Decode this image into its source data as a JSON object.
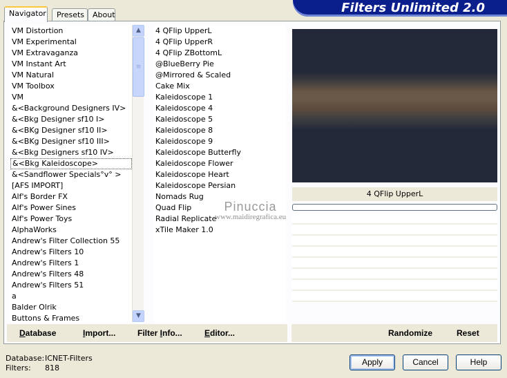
{
  "tabs": [
    {
      "label": "Navigator",
      "active": true
    },
    {
      "label": "Presets",
      "active": false
    },
    {
      "label": "About",
      "active": false
    }
  ],
  "banner": {
    "title": "Filters Unlimited 2.0"
  },
  "categories": [
    "VM Distortion",
    "VM Experimental",
    "VM Extravaganza",
    "VM Instant Art",
    "VM Natural",
    "VM Toolbox",
    "VM",
    "&<Background Designers IV>",
    "&<Bkg Designer sf10 I>",
    "&<BKg Designer sf10 II>",
    "&<BKg Designer sf10 III>",
    "&<Bkg Designers sf10 IV>",
    "&<Bkg Kaleidoscope>",
    "&<Sandflower Specials°v° >",
    "[AFS IMPORT]",
    "Alf's Border FX",
    "Alf's Power Sines",
    "Alf's Power Toys",
    "AlphaWorks",
    "Andrew's Filter Collection 55",
    "Andrew's Filters 10",
    "Andrew's Filters 1",
    "Andrew's Filters 48",
    "Andrew's Filters 51",
    "a",
    "Balder Olrik",
    "Buttons & Frames"
  ],
  "selected_category_index": 12,
  "filters": [
    "4 QFlip UpperL",
    "4 QFlip UpperR",
    "4 QFlip ZBottomL",
    "@BlueBerry Pie",
    "@Mirrored & Scaled",
    "Cake Mix",
    "Kaleidoscope 1",
    "Kaleidoscope 4",
    "Kaleidoscope 5",
    "Kaleidoscope 8",
    "Kaleidoscope 9",
    "Kaleidoscope Butterfly",
    "Kaleidoscope Flower",
    "Kaleidoscope Heart",
    "Kaleidoscope Persian",
    "Nomads Rug",
    "Quad Flip",
    "Radial Replicate",
    "xTile Maker 1.0"
  ],
  "selected_filter_index": 0,
  "preview": {
    "filter_name": "4 QFlip UpperL",
    "progress": 0
  },
  "watermark": {
    "line1": "Pinuccia",
    "line2": "www.maidiregrafica.eu"
  },
  "left_buttons": {
    "database": {
      "u": "D",
      "rest": "atabase"
    },
    "import": {
      "u": "I",
      "rest": "mport..."
    },
    "filter_info": {
      "pre": "Filter ",
      "u": "I",
      "rest": "nfo..."
    },
    "editor": {
      "u": "E",
      "rest": "ditor..."
    }
  },
  "right_buttons": {
    "randomize": "Randomize",
    "reset": "Reset"
  },
  "status": {
    "db_key": "Database:",
    "db_val": "ICNET-Filters",
    "filters_key": "Filters:",
    "filters_val": "818"
  },
  "dialog_buttons": {
    "apply": "Apply",
    "cancel": "Cancel",
    "help": "Help"
  },
  "colors": {
    "selection": "#316AC5",
    "banner": "#0A1E8C"
  }
}
